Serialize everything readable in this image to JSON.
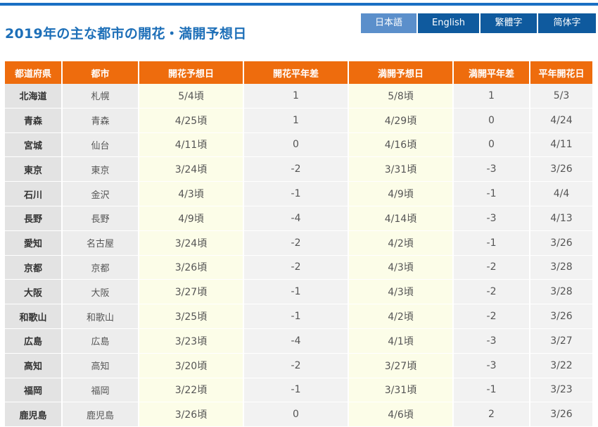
{
  "title": "2019年の主な都市の開花・満開予想日",
  "languages": [
    "日本語",
    "English",
    "繁體字",
    "简体字"
  ],
  "active_language": "日本語",
  "colors": {
    "header_bg": "#ee6c0d",
    "title": "#1d6fb8",
    "lang_active": "#5b8fcb",
    "lang_inactive": "#0f5a9e",
    "highlight_column": "#fcfde8"
  },
  "table": {
    "headers": [
      "都道府県",
      "都市",
      "開花予想日",
      "開花平年差",
      "満開予想日",
      "満開平年差",
      "平年開花日"
    ],
    "rows": [
      [
        "北海道",
        "札幌",
        "5/4頃",
        "1",
        "5/8頃",
        "1",
        "5/3"
      ],
      [
        "青森",
        "青森",
        "4/25頃",
        "1",
        "4/29頃",
        "0",
        "4/24"
      ],
      [
        "宮城",
        "仙台",
        "4/11頃",
        "0",
        "4/16頃",
        "0",
        "4/11"
      ],
      [
        "東京",
        "東京",
        "3/24頃",
        "-2",
        "3/31頃",
        "-3",
        "3/26"
      ],
      [
        "石川",
        "金沢",
        "4/3頃",
        "-1",
        "4/9頃",
        "-1",
        "4/4"
      ],
      [
        "長野",
        "長野",
        "4/9頃",
        "-4",
        "4/14頃",
        "-3",
        "4/13"
      ],
      [
        "愛知",
        "名古屋",
        "3/24頃",
        "-2",
        "4/2頃",
        "-1",
        "3/26"
      ],
      [
        "京都",
        "京都",
        "3/26頃",
        "-2",
        "4/3頃",
        "-2",
        "3/28"
      ],
      [
        "大阪",
        "大阪",
        "3/27頃",
        "-1",
        "4/3頃",
        "-2",
        "3/28"
      ],
      [
        "和歌山",
        "和歌山",
        "3/25頃",
        "-1",
        "4/2頃",
        "-2",
        "3/26"
      ],
      [
        "広島",
        "広島",
        "3/23頃",
        "-4",
        "4/1頃",
        "-3",
        "3/27"
      ],
      [
        "高知",
        "高知",
        "3/20頃",
        "-2",
        "3/27頃",
        "-3",
        "3/22"
      ],
      [
        "福岡",
        "福岡",
        "3/22頃",
        "-1",
        "3/31頃",
        "-1",
        "3/23"
      ],
      [
        "鹿児島",
        "鹿児島",
        "3/26頃",
        "0",
        "4/6頃",
        "2",
        "3/26"
      ]
    ]
  }
}
